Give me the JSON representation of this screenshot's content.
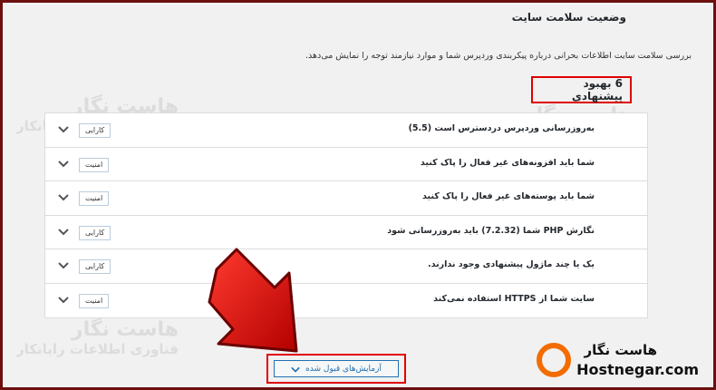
{
  "page": {
    "title": "وضعیت سلامت سایت",
    "description": "بررسی سلامت سایت اطلاعات بحرانی درباره پیکربندی وردپرس شما و موارد نیازمند توجه را نمایش می‌دهد.",
    "improvements_count": "6 بهبود پیشنهادی"
  },
  "items": [
    {
      "title": "به‌روزرسانی وردپرس دردسترس است (5.5)",
      "badge": "کارایی"
    },
    {
      "title": "شما باید افزونه‌های غیر فعال را پاک کنید",
      "badge": "امنیت"
    },
    {
      "title": "شما باید پوسته‌های غیر فعال را پاک کنید",
      "badge": "امنیت"
    },
    {
      "title": "نگارش PHP شما (7.2.32) باید به‌روزرسانی شود",
      "badge": "کارایی"
    },
    {
      "title": "یک یا چند ماژول پیشنهادی وجود ندارند.",
      "badge": "کارایی"
    },
    {
      "title": "سایت شما از HTTPS استفاده نمی‌کند",
      "badge": "امنیت"
    }
  ],
  "accept_button": {
    "label": "آزمایش‌های قبول شده"
  },
  "watermark": {
    "line1": "هاست نگار",
    "line2": "فناوری اطلاعات رایانکار"
  },
  "logo": {
    "fa": "هاست نگار",
    "en": "Hostnegar.com"
  },
  "colors": {
    "highlight": "#e00000",
    "accent": "#2271b1",
    "brand": "#f36c00"
  }
}
